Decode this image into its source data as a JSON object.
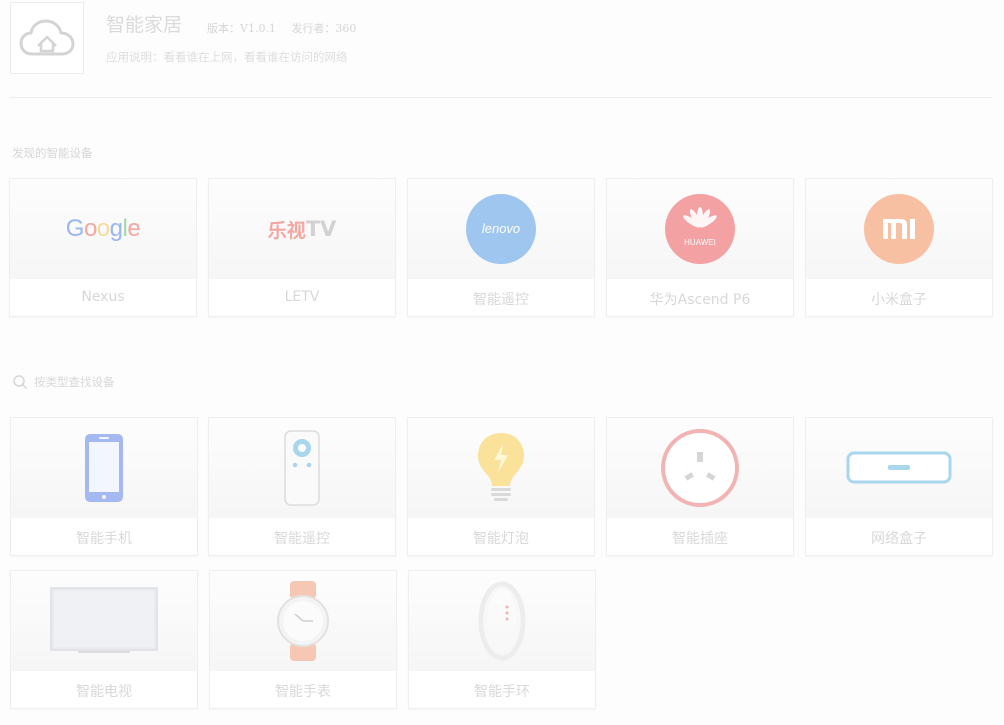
{
  "app": {
    "title": "智能家居",
    "version": "版本：V1.0.1",
    "publisher": "发行者：360",
    "description": "应用说明：看看谁在上网，看看谁在访问的网络"
  },
  "discovered": {
    "section_title": "发现的智能设备",
    "devices": [
      {
        "label": "Nexus",
        "icon": "google-logo"
      },
      {
        "label": "LETV",
        "icon": "letv-logo"
      },
      {
        "label": "智能遥控",
        "icon": "lenovo-logo"
      },
      {
        "label": "华为Ascend P6",
        "icon": "huawei-logo"
      },
      {
        "label": "小米盒子",
        "icon": "mi-logo"
      }
    ]
  },
  "search": {
    "label": "按类型查找设备"
  },
  "categories": [
    {
      "label": "智能手机",
      "icon": "smartphone-icon"
    },
    {
      "label": "智能遥控",
      "icon": "remote-control-icon"
    },
    {
      "label": "智能灯泡",
      "icon": "light-bulb-icon"
    },
    {
      "label": "智能插座",
      "icon": "power-socket-icon"
    },
    {
      "label": "网络盒子",
      "icon": "network-box-icon"
    },
    {
      "label": "智能电视",
      "icon": "television-icon"
    },
    {
      "label": "智能手表",
      "icon": "smartwatch-icon"
    },
    {
      "label": "智能手环",
      "icon": "fitness-band-icon"
    }
  ],
  "logos": {
    "google": "Google",
    "letv_cn": "乐视",
    "letv_en": "TV",
    "lenovo": "lenovo",
    "huawei": "HUAWEI",
    "mi": "MI"
  },
  "colors": {
    "google_blue": "#9bb7f0",
    "google_red": "#f3a8a0",
    "google_yellow": "#f6dc9c",
    "google_green": "#a5d6ae",
    "letv_red": "#f4a6a0",
    "lenovo_blue": "#9fc6ee",
    "huawei_red": "#f3a1a3",
    "mi_orange": "#f8c0a3",
    "device_blue": "#a4b8f2",
    "bulb_yellow": "#fbe29a",
    "socket_red": "#f2b3b3",
    "netbox_blue": "#a8d6ec"
  }
}
